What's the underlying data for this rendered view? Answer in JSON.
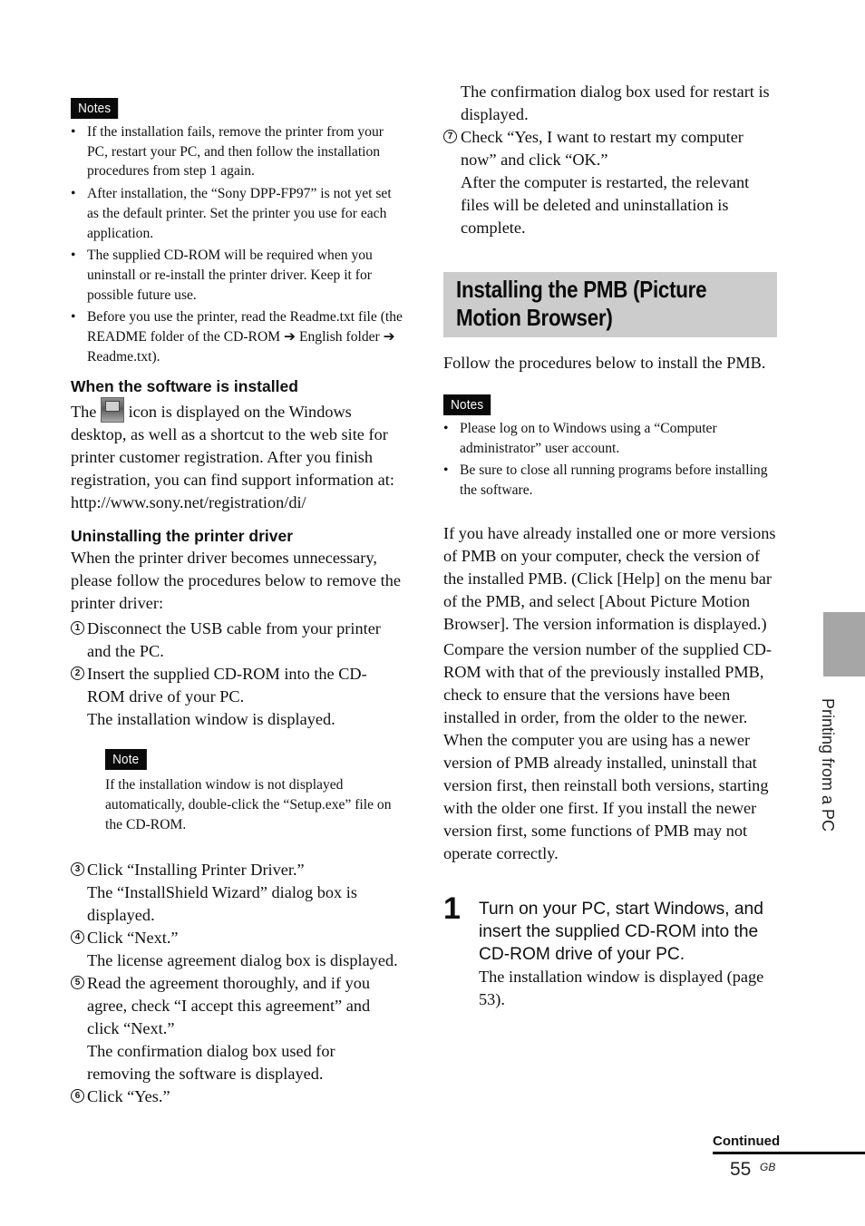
{
  "left": {
    "notes_label": "Notes",
    "notes": [
      "If the installation fails, remove the printer from your PC, restart your PC, and then follow the installation procedures from step 1 again.",
      "After installation, the “Sony DPP-FP97” is not yet set as the default printer. Set the printer you use for each application.",
      "The supplied CD-ROM will be required when you uninstall or re-install the printer driver. Keep it for possible future use.",
      "Before you use the printer, read the Readme.txt file (the README folder of the CD-ROM ➔ English folder ➔ Readme.txt)."
    ],
    "installed_heading": "When the software is installed",
    "installed_text_before_icon": "The",
    "installed_icon": "printer-customer-registration-icon",
    "installed_text_after_icon": "icon is displayed on the Windows desktop, as well as a shortcut to the web site for printer customer registration. After you finish registration, you can find support information at: http://www.sony.net/registration/di/",
    "uninstall_heading": "Uninstalling the printer driver",
    "uninstall_intro": "When the printer driver becomes unnecessary, please follow the procedures below to remove the printer driver:",
    "steps_a": [
      {
        "num": "1",
        "text": "Disconnect the USB cable from your printer and the PC.",
        "result": ""
      },
      {
        "num": "2",
        "text": "Insert the supplied CD-ROM into the CD-ROM drive of your PC.",
        "result": "The installation window is displayed."
      }
    ],
    "note_label": "Note",
    "note_text": "If the installation window is not displayed automatically, double-click the “Setup.exe” file on the CD-ROM.",
    "steps_b": [
      {
        "num": "3",
        "text": "Click “Installing Printer Driver.”",
        "result": "The “InstallShield Wizard” dialog box is displayed."
      },
      {
        "num": "4",
        "text": "Click “Next.”",
        "result": "The license agreement dialog box is displayed."
      },
      {
        "num": "5",
        "text": "Read the agreement thoroughly, and if you agree, check “I accept this agreement” and click “Next.”",
        "result": "The confirmation dialog box used for removing the software is displayed."
      },
      {
        "num": "6",
        "text": "Click “Yes.”",
        "result": ""
      }
    ]
  },
  "right": {
    "continued_result": "The confirmation dialog box used for restart is displayed.",
    "step7": {
      "num": "7",
      "text": "Check “Yes, I want to restart my computer now” and click “OK.”",
      "result": "After the computer is restarted, the relevant files will be deleted and uninstallation is complete."
    },
    "section_title": "Installing the PMB (Picture Motion Browser)",
    "intro": "Follow the procedures below to install the PMB.",
    "notes_label": "Notes",
    "notes": [
      "Please log on to Windows using a “Computer administrator” user account.",
      "Be sure to close all running programs before installing the software."
    ],
    "para1": "If you have already installed one or more versions of PMB on your computer, check the version of the installed PMB. (Click [Help] on the menu bar of the PMB, and select [About Picture Motion Browser]. The version information is displayed.)",
    "para2": "Compare the version number of the supplied CD-ROM with that of the previously installed PMB, check to ensure that the versions have been installed in order, from the older to the newer. When the computer you are using has a newer version of PMB already installed, uninstall that version first, then reinstall both versions, starting with the older one first. If you install the newer version first, some functions of PMB may not operate correctly.",
    "big_step": {
      "num": "1",
      "instruction": "Turn on your PC, start Windows, and insert the supplied CD-ROM into the CD-ROM drive of your PC.",
      "result": "The installation window is displayed (page 53)."
    }
  },
  "side": {
    "tab_label": "Printing from a PC",
    "tab_color": "#a6a6a6"
  },
  "footer": {
    "continued": "Continued",
    "page_number": "55",
    "page_suffix": "GB"
  }
}
